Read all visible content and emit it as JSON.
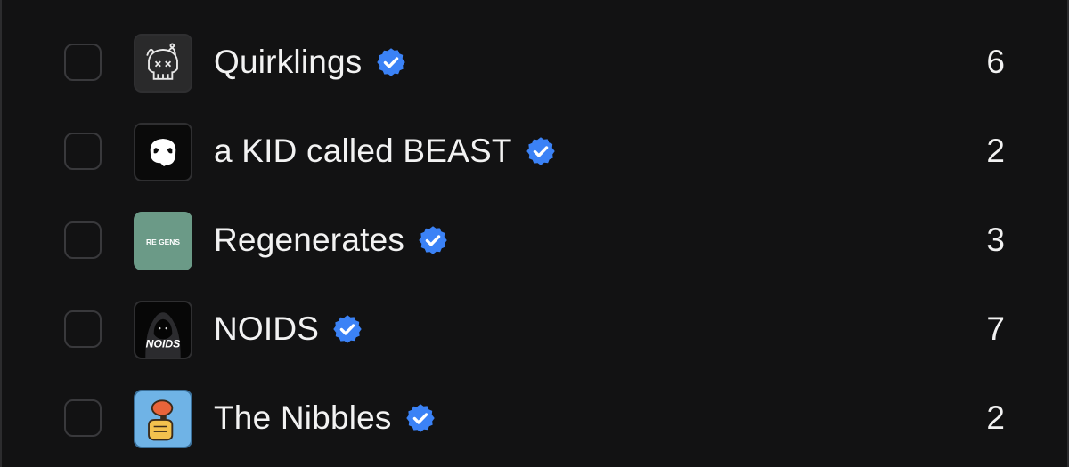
{
  "colors": {
    "background": "#121213",
    "text": "#f2f2f2",
    "verified_badge": "#3b82f6",
    "checkbox_border": "#39393c"
  },
  "collections": [
    {
      "name": "Quirklings",
      "verified": true,
      "count": "6",
      "checked": false,
      "thumb_icon": "skull-icon"
    },
    {
      "name": "a KID called BEAST",
      "verified": true,
      "count": "2",
      "checked": false,
      "thumb_icon": "beast-head-icon"
    },
    {
      "name": "Regenerates",
      "verified": true,
      "count": "3",
      "checked": false,
      "thumb_icon": "regens-logo-icon",
      "thumb_text": "RE GENS"
    },
    {
      "name": "NOIDS",
      "verified": true,
      "count": "7",
      "checked": false,
      "thumb_icon": "hooded-figure-icon",
      "thumb_text": "NOIDS"
    },
    {
      "name": "The Nibbles",
      "verified": true,
      "count": "2",
      "checked": false,
      "thumb_icon": "thumbs-up-icon"
    }
  ]
}
